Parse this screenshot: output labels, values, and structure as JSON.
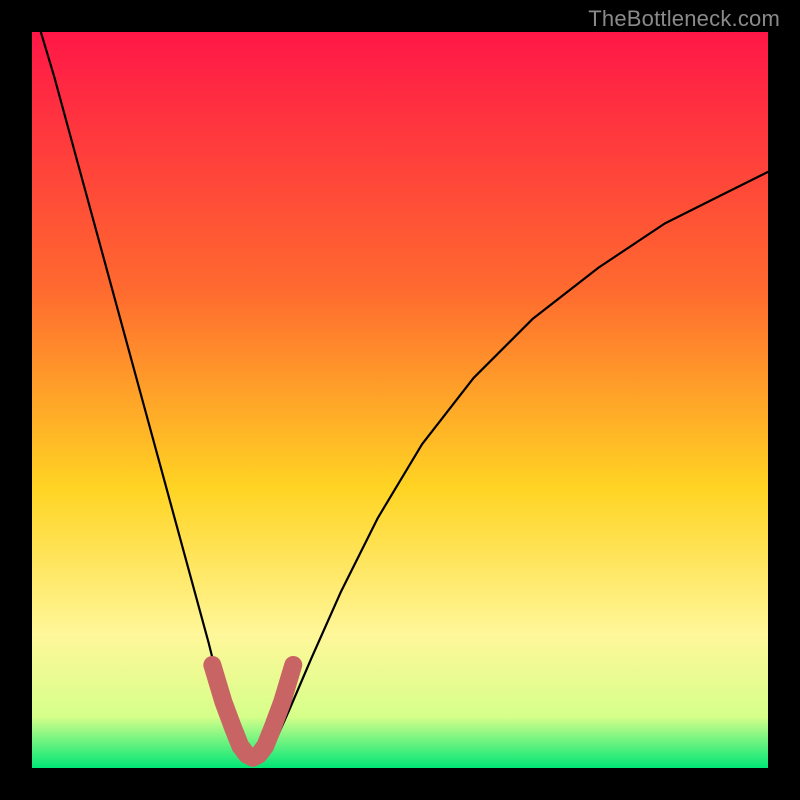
{
  "watermark": "TheBottleneck.com",
  "colors": {
    "frame": "#000000",
    "gradient_top": "#ff1747",
    "gradient_mid1": "#ff6a2f",
    "gradient_mid2": "#ffd423",
    "gradient_mid3": "#fff79a",
    "gradient_bottom1": "#d6ff8a",
    "gradient_bottom2": "#00e676",
    "curve": "#000000",
    "highlight": "#c86464"
  },
  "chart_data": {
    "type": "line",
    "title": "",
    "xlabel": "",
    "ylabel": "",
    "xlim": [
      0,
      100
    ],
    "ylim": [
      0,
      100
    ],
    "grid": false,
    "series": [
      {
        "name": "bottleneck-curve",
        "x": [
          0,
          3,
          6,
          9,
          12,
          15,
          18,
          21,
          24,
          26,
          28,
          29.5,
          31,
          33,
          35,
          38,
          42,
          47,
          53,
          60,
          68,
          77,
          86,
          94,
          100
        ],
        "y": [
          104,
          94,
          83,
          72,
          61,
          50,
          39,
          28,
          17,
          9,
          3.5,
          1.5,
          1.5,
          3.5,
          8,
          15,
          24,
          34,
          44,
          53,
          61,
          68,
          74,
          78,
          81
        ]
      },
      {
        "name": "highlight-segment",
        "x": [
          24.5,
          26,
          27.3,
          28.3,
          29.2,
          30,
          30.8,
          31.7,
          32.7,
          34,
          35.5
        ],
        "y": [
          14,
          9,
          5.5,
          3,
          1.8,
          1.4,
          1.8,
          3,
          5.5,
          9,
          14
        ]
      }
    ],
    "annotations": []
  }
}
